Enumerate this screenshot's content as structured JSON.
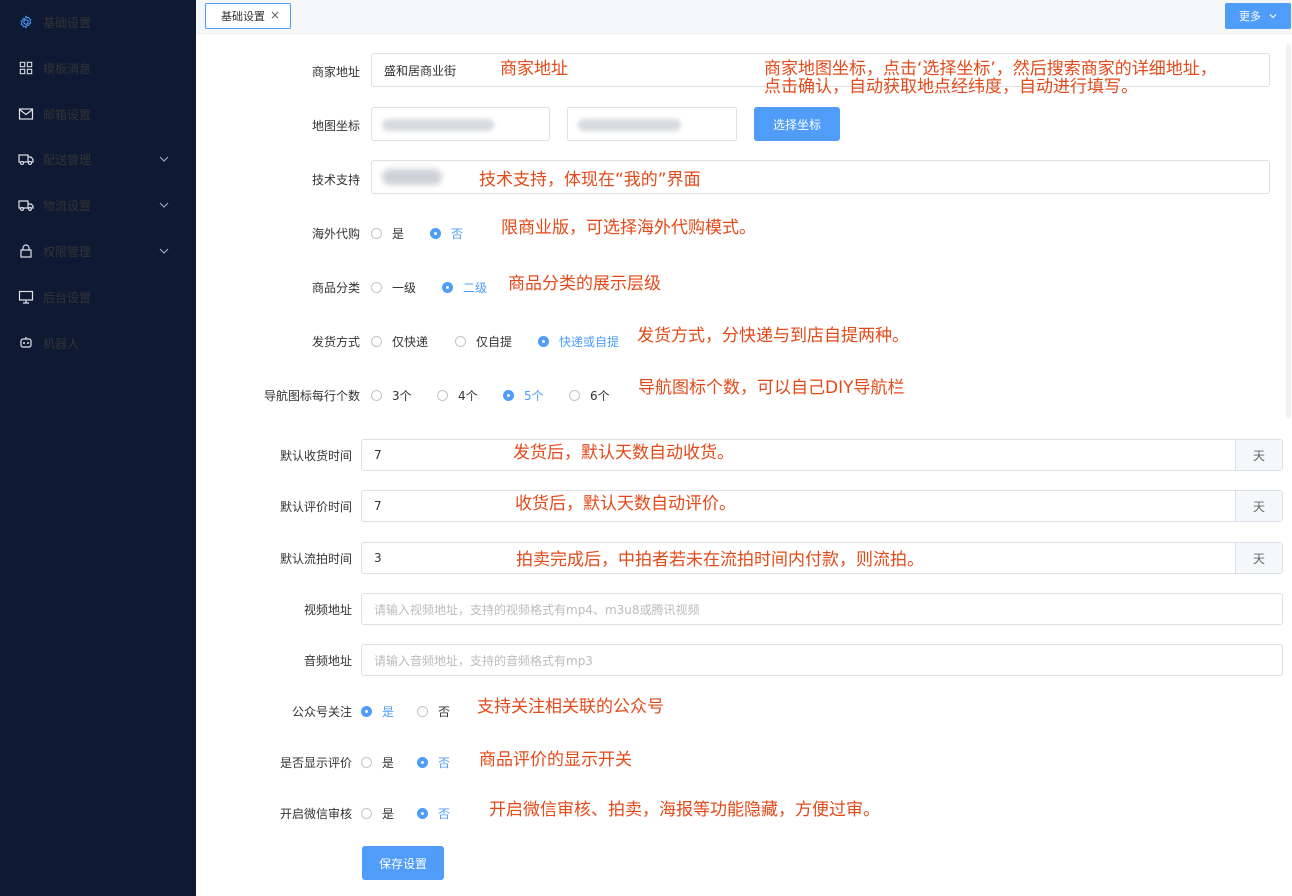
{
  "sidebar": {
    "items": [
      {
        "label": "基础设置",
        "icon": "gear-icon",
        "active": true
      },
      {
        "label": "模板消息",
        "icon": "grid-icon"
      },
      {
        "label": "邮箱设置",
        "icon": "mail-icon"
      },
      {
        "label": "配送管理",
        "icon": "truck-icon",
        "expandable": true
      },
      {
        "label": "物流设置",
        "icon": "delivery-icon",
        "expandable": true
      },
      {
        "label": "权限管理",
        "icon": "lock-icon",
        "expandable": true
      },
      {
        "label": "后台设置",
        "icon": "monitor-icon"
      },
      {
        "label": "机器人",
        "icon": "robot-icon"
      }
    ]
  },
  "tabs": {
    "active_label": "基础设置",
    "close_glyph": "×",
    "more_label": "更多"
  },
  "colors": {
    "accent": "#4f9cf9",
    "sidebar_bg": "#0e1a33",
    "annotation": "#e34a1a"
  },
  "form": {
    "merchant_address": {
      "label": "商家地址",
      "value": "盛和居商业街"
    },
    "map_coords": {
      "label": "地图坐标",
      "select_button": "选择坐标"
    },
    "tech_support": {
      "label": "技术支持"
    },
    "overseas": {
      "label": "海外代购",
      "options": [
        "是",
        "否"
      ],
      "selected": "否"
    },
    "category": {
      "label": "商品分类",
      "options": [
        "一级",
        "二级"
      ],
      "selected": "二级"
    },
    "shipping": {
      "label": "发货方式",
      "options": [
        "仅快递",
        "仅自提",
        "快递或自提"
      ],
      "selected": "快递或自提"
    },
    "nav_icons": {
      "label": "导航图标每行个数",
      "options": [
        "3个",
        "4个",
        "5个",
        "6个"
      ],
      "selected": "5个"
    },
    "receive_time": {
      "label": "默认收货时间",
      "value": "7",
      "unit": "天"
    },
    "review_time": {
      "label": "默认评价时间",
      "value": "7",
      "unit": "天"
    },
    "auction_time": {
      "label": "默认流拍时间",
      "value": "3",
      "unit": "天"
    },
    "video_url": {
      "label": "视频地址",
      "placeholder": "请输入视频地址，支持的视频格式有mp4、m3u8或腾讯视频"
    },
    "audio_url": {
      "label": "音频地址",
      "placeholder": "请输入音频地址，支持的音频格式有mp3"
    },
    "follow_mp": {
      "label": "公众号关注",
      "options": [
        "是",
        "否"
      ],
      "selected": "是"
    },
    "show_review": {
      "label": "是否显示评价",
      "options": [
        "是",
        "否"
      ],
      "selected": "否"
    },
    "wechat_audit": {
      "label": "开启微信审核",
      "options": [
        "是",
        "否"
      ],
      "selected": "否"
    },
    "save_button": "保存设置"
  },
  "annotations": {
    "merchant_address": "商家地址",
    "map_coords_line1": "商家地图坐标，点击‘选择坐标’，然后搜索商家的详细地址，",
    "map_coords_line2": "点击确认，自动获取地点经纬度，自动进行填写。",
    "tech_support": "技术支持，体现在“我的”界面",
    "overseas": "限商业版，可选择海外代购模式。",
    "category": "商品分类的展示层级",
    "shipping": "发货方式，分快递与到店自提两种。",
    "nav_icons": "导航图标个数，可以自己DIY导航栏",
    "receive_time": "发货后，默认天数自动收货。",
    "review_time": "收货后，默认天数自动评价。",
    "auction_time": "拍卖完成后，中拍者若未在流拍时间内付款，则流拍。",
    "follow_mp": "支持关注相关联的公众号",
    "show_review": "商品评价的显示开关",
    "wechat_audit": "开启微信审核、拍卖，海报等功能隐藏，方便过审。"
  }
}
